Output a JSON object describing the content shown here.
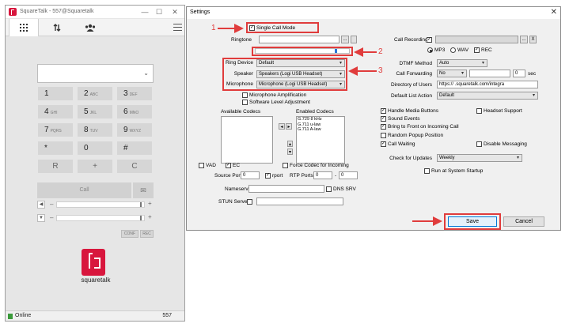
{
  "phone": {
    "title": "SquareTalk - 557@Squaretalk",
    "window_controls": {
      "minimize": "—",
      "maximize": "☐",
      "close": "✕"
    },
    "keys": [
      {
        "digit": "1",
        "letters": ""
      },
      {
        "digit": "2",
        "letters": "ABC"
      },
      {
        "digit": "3",
        "letters": "DEF"
      },
      {
        "digit": "4",
        "letters": "GHI"
      },
      {
        "digit": "5",
        "letters": "JKL"
      },
      {
        "digit": "6",
        "letters": "MNO"
      },
      {
        "digit": "7",
        "letters": "PQRS"
      },
      {
        "digit": "8",
        "letters": "TUV"
      },
      {
        "digit": "9",
        "letters": "WXYZ"
      },
      {
        "digit": "*",
        "letters": ""
      },
      {
        "digit": "0",
        "letters": ""
      },
      {
        "digit": "#",
        "letters": ""
      },
      {
        "digit": "R",
        "letters": ""
      },
      {
        "digit": "+",
        "letters": ""
      },
      {
        "digit": "C",
        "letters": ""
      }
    ],
    "call_label": "Call",
    "vol_minus": "–",
    "vol_plus": "+",
    "conf_label": "CONF",
    "rec_label": "REC",
    "brand": "squaretalk",
    "status": "Online",
    "extension": "557"
  },
  "settings": {
    "title": "Settings",
    "close": "✕",
    "single_call_mode": "Single Call Mode",
    "ringtone_label": "Ringtone",
    "browse": "...",
    "audio_progress": 0.85,
    "ring_device_label": "Ring Device",
    "ring_device_value": "Default",
    "speaker_label": "Speaker",
    "speaker_value": "Speakers (Logi USB Headset)",
    "microphone_label": "Microphone",
    "microphone_value": "Microphone (Logi USB Headset)",
    "mic_amplification": "Microphone Amplification",
    "software_level_adjustment": "Software Level Adjustment",
    "available_codecs_label": "Available Codecs",
    "enabled_codecs_label": "Enabled Codecs",
    "enabled_codecs": [
      "G.729 8 kHz",
      "G.711 u-law",
      "G.711 A-law"
    ],
    "vad": "VAD",
    "ec": "EC",
    "force_codec": "Force Codec for Incoming",
    "source_port_label": "Source Port",
    "source_port_value": "0",
    "rport": "rport",
    "rtp_ports_label": "RTP Ports",
    "rtp_from": "0",
    "rtp_sep": "-",
    "rtp_to": "0",
    "nameserver_label": "Nameserver",
    "dns_srv": "DNS SRV",
    "stun_label": "STUN Server",
    "call_recording_label": "Call Recording",
    "clear_btn": "X",
    "mp3": "MP3",
    "wav": "WAV",
    "rec": "REC",
    "dtmf_label": "DTMF Method",
    "dtmf_value": "Auto",
    "forwarding_label": "Call Forwarding",
    "forwarding_value": "No",
    "forwarding_sec_value": "0",
    "sec": "sec",
    "directory_label": "Directory of Users",
    "directory_value": "https://             .squaretalk.com/integra",
    "default_list_label": "Default List Action",
    "default_list_value": "Default",
    "handle_media": "Handle Media Buttons",
    "headset_support": "Headset Support",
    "sound_events": "Sound Events",
    "bring_front": "Bring to Front on Incoming Call",
    "random_popup": "Random Popup Position",
    "call_waiting": "Call Waiting",
    "disable_messaging": "Disable Messaging",
    "check_updates_label": "Check for Updates",
    "check_updates_value": "Weekly",
    "run_startup": "Run at System Startup",
    "save": "Save",
    "cancel": "Cancel"
  },
  "annotations": {
    "a1": "1",
    "a2": "2",
    "a3": "3"
  },
  "colors": {
    "brand": "#d8163d",
    "highlight": "#e03c3c",
    "online": "#3a9a3a"
  }
}
